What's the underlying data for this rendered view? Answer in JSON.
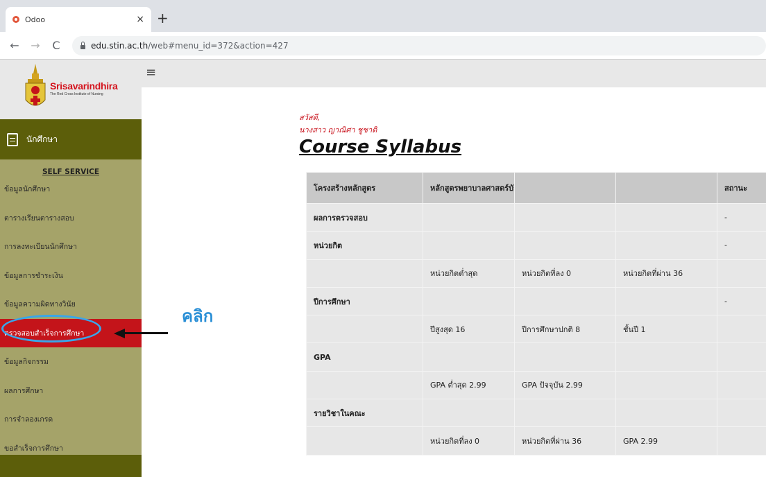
{
  "browser": {
    "tab_title": "Odoo",
    "tab_close": "×",
    "new_tab": "+",
    "url_host": "edu.stin.ac.th",
    "url_path": "/web#menu_id=372&action=427"
  },
  "logo": {
    "name": "Srisavarindhira",
    "sub": "The Red Cross Institute of Nursing"
  },
  "sidebar": {
    "header_label": "นักศึกษา",
    "section_title": "SELF SERVICE",
    "items": [
      {
        "label": "ข้อมูลนักศึกษา"
      },
      {
        "label": "ตารางเรียนตารางสอบ"
      },
      {
        "label": "การลงทะเบียนนักศึกษา"
      },
      {
        "label": "ข้อมูลการชำระเงิน"
      },
      {
        "label": "ข้อมูลความผิดทางวินัย"
      },
      {
        "label": "ตรวจสอบสำเร็จการศึกษา"
      },
      {
        "label": "ข้อมูลกิจกรรม"
      },
      {
        "label": "ผลการศึกษา"
      },
      {
        "label": "การจำลองเกรด"
      },
      {
        "label": "ขอสำเร็จการศึกษา"
      }
    ],
    "active_index": 5
  },
  "annotation": {
    "click_label": "คลิก"
  },
  "greeting": {
    "line1": "สวัสดี,",
    "line2": "นางสาว ญาณิศา ชูชาติ"
  },
  "page_title": "Course Syllabus",
  "table": {
    "header": [
      "โครงสร้างหลักสูตร",
      "หลักสูตรพยาบาลศาสตร์บัณฑิต",
      "",
      "",
      "สถานะ"
    ],
    "rows": [
      [
        "ผลการตรวจสอบ",
        "",
        "",
        "",
        "-"
      ],
      [
        "หน่วยกิต",
        "",
        "",
        "",
        "-"
      ],
      [
        "",
        "หน่วยกิตต่ำสุด",
        "หน่วยกิตที่ลง 0",
        "หน่วยกิตที่ผ่าน 36",
        ""
      ],
      [
        "ปีการศึกษา",
        "",
        "",
        "",
        "-"
      ],
      [
        "",
        "ปีสูงสุด 16",
        "ปีการศึกษาปกติ 8",
        "ชั้นปี 1",
        ""
      ],
      [
        "GPA",
        "",
        "",
        "",
        ""
      ],
      [
        "",
        "GPA ต่ำสุด 2.99",
        "GPA ปัจจุบัน 2.99",
        "",
        ""
      ],
      [
        "รายวิชาในคณะ",
        "",
        "",
        "",
        ""
      ],
      [
        "",
        "หน่วยกิตที่ลง 0",
        "หน่วยกิตที่ผ่าน 36",
        "GPA 2.99",
        ""
      ]
    ]
  },
  "colors": {
    "sidebar_bg": "#a5a369",
    "sidebar_header": "#5c5e0a",
    "active_item": "#c4141a",
    "highlight_ring": "#39a6ea",
    "click_text": "#2a8fd6",
    "greeting": "#c8101a"
  }
}
